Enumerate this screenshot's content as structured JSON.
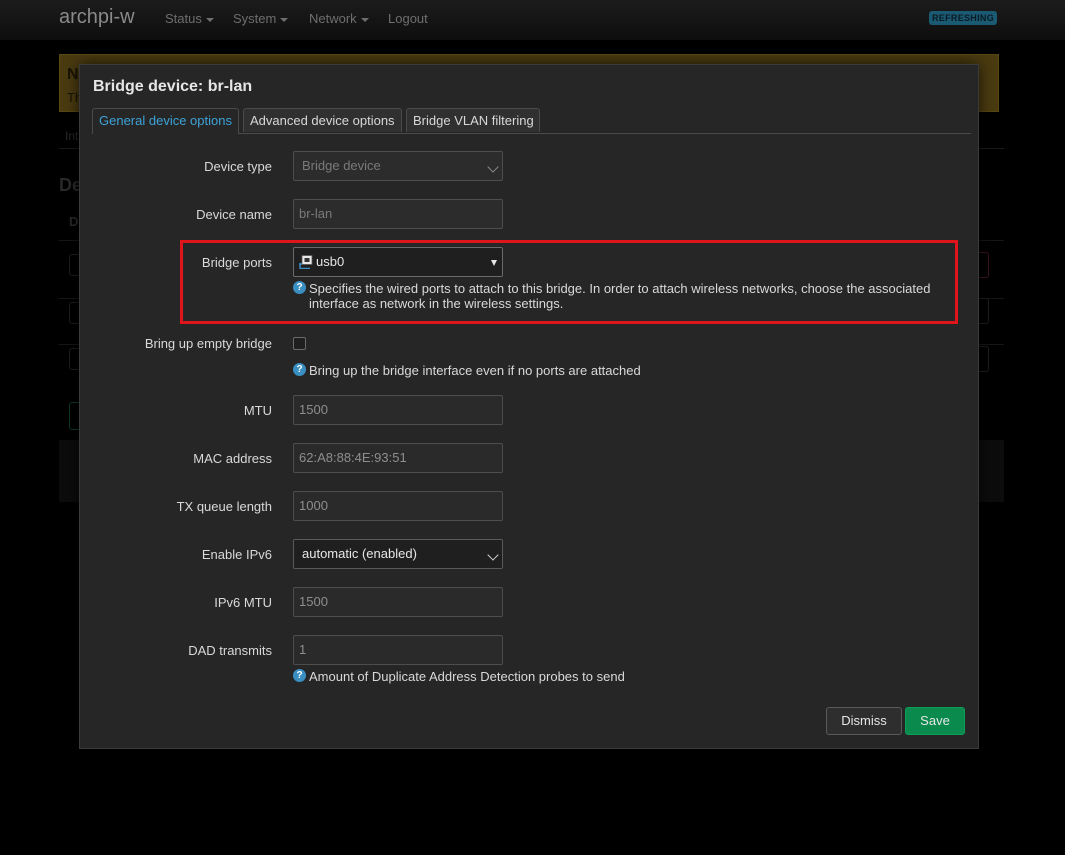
{
  "header": {
    "brand": "archpi-w",
    "nav": [
      "Status",
      "System",
      "Network"
    ],
    "logout": "Logout",
    "badge": "REFRESHING"
  },
  "background": {
    "warning_title": "N",
    "warning_text": "Th",
    "tab": "Int",
    "heading": "De",
    "col": "D"
  },
  "modal": {
    "title": "Bridge device: br-lan",
    "tabs": [
      "General device options",
      "Advanced device options",
      "Bridge VLAN filtering"
    ],
    "fields": {
      "device_type": {
        "label": "Device type",
        "value": "Bridge device"
      },
      "device_name": {
        "label": "Device name",
        "value": "br-lan"
      },
      "bridge_ports": {
        "label": "Bridge ports",
        "value": "usb0",
        "help": "Specifies the wired ports to attach to this bridge. In order to attach wireless networks, choose the associated interface as network in the wireless settings."
      },
      "empty_bridge": {
        "label": "Bring up empty bridge",
        "help": "Bring up the bridge interface even if no ports are attached"
      },
      "mtu": {
        "label": "MTU",
        "placeholder": "1500"
      },
      "mac": {
        "label": "MAC address",
        "placeholder": "62:A8:88:4E:93:51"
      },
      "txqueue": {
        "label": "TX queue length",
        "placeholder": "1000"
      },
      "ipv6": {
        "label": "Enable IPv6",
        "value": "automatic (enabled)"
      },
      "ipv6mtu": {
        "label": "IPv6 MTU",
        "placeholder": "1500"
      },
      "dad": {
        "label": "DAD transmits",
        "placeholder": "1",
        "help": "Amount of Duplicate Address Detection probes to send"
      }
    },
    "buttons": {
      "dismiss": "Dismiss",
      "save": "Save"
    }
  },
  "colors": {
    "accent": "#3da3d8",
    "save": "#0a8a4d",
    "highlight": "#e0141b"
  }
}
